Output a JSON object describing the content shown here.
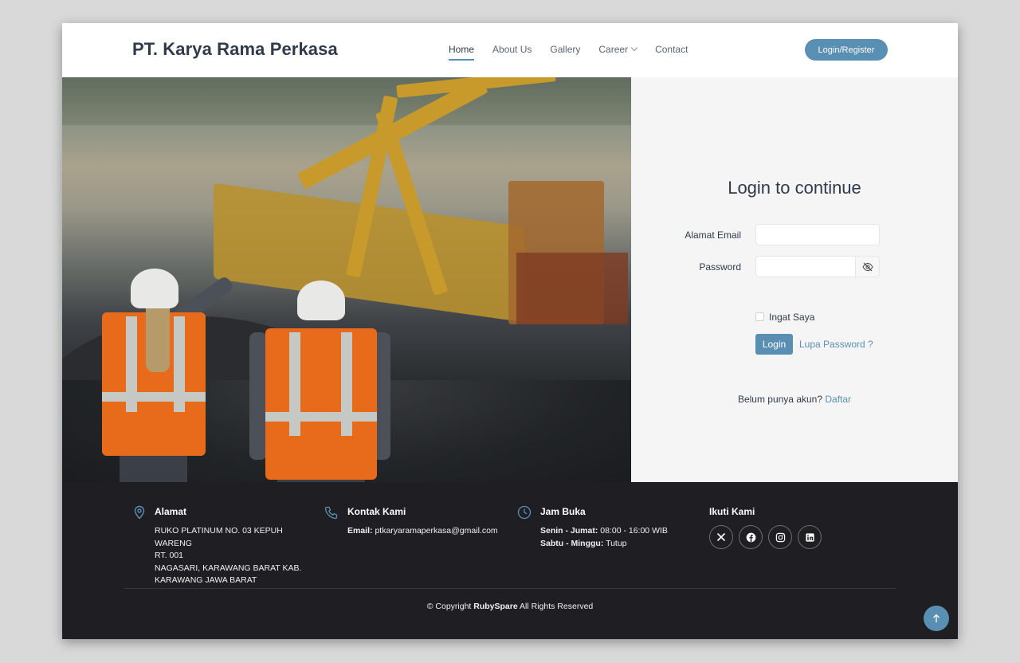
{
  "header": {
    "brand": "PT. Karya Rama Perkasa",
    "nav": {
      "home": "Home",
      "about": "About Us",
      "gallery": "Gallery",
      "career": "Career",
      "contact": "Contact"
    },
    "login_register": "Login/Register"
  },
  "login": {
    "title": "Login to continue",
    "email_label": "Alamat Email",
    "email_value": "",
    "password_label": "Password",
    "password_value": "",
    "remember_label": "Ingat Saya",
    "login_button": "Login",
    "forgot_link": "Lupa Password ?",
    "signup_prompt": "Belum punya akun?",
    "signup_link": "Daftar"
  },
  "footer": {
    "address": {
      "heading": "Alamat",
      "line1": "RUKO PLATINUM NO. 03 KEPUH WARENG",
      "line2": "RT. 001",
      "line3": "NAGASARI, KARAWANG BARAT KAB.",
      "line4": "KARAWANG JAWA BARAT"
    },
    "contact": {
      "heading": "Kontak Kami",
      "email_label": "Email:",
      "email": "ptkaryaramaperkasa@gmail.com"
    },
    "hours": {
      "heading": "Jam Buka",
      "weekday_label": "Senin - Jumat:",
      "weekday": "08:00 - 16:00 WIB",
      "weekend_label": "Sabtu - Minggu:",
      "weekend": "Tutup"
    },
    "follow": {
      "heading": "Ikuti Kami",
      "icons": [
        "x-icon",
        "facebook-icon",
        "instagram-icon",
        "linkedin-icon"
      ]
    },
    "copyright_prefix": "© Copyright",
    "copyright_brand": "RubySpare",
    "copyright_suffix": "All Rights Reserved"
  },
  "colors": {
    "accent": "#5a8fb4",
    "footer_bg": "#1f1f23",
    "panel_bg": "#f5f5f5",
    "text_dark": "#2f3a4a"
  }
}
